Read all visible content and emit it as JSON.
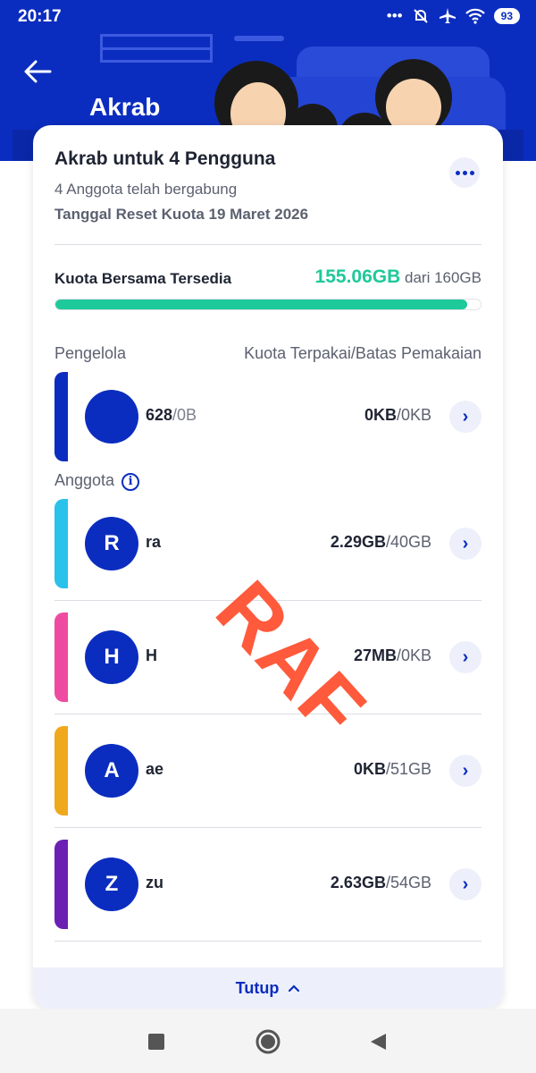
{
  "status_bar": {
    "time": "20:17",
    "battery": "93",
    "icons": [
      "more-dots-icon",
      "mute-bell-icon",
      "airplane-icon",
      "wifi-icon",
      "battery-icon"
    ]
  },
  "header": {
    "title": "Akrab"
  },
  "plan": {
    "title": "Akrab untuk 4 Pengguna",
    "members_joined": "4 Anggota telah bergabung",
    "reset_date": "Tanggal Reset Kuota 19 Maret 2026"
  },
  "quota": {
    "label": "Kuota Bersama Tersedia",
    "available": "155.06GB",
    "total_text": "dari 160GB",
    "available_fraction": 0.969
  },
  "manager_section": {
    "left_label": "Pengelola",
    "right_label": "Kuota Terpakai/Batas Pemakaian",
    "manager": {
      "name": "628",
      "name_faint": "/0B",
      "used": "0KB",
      "limit": "/0KB",
      "accent": "#0b2dbf"
    }
  },
  "members_section": {
    "label": "Anggota",
    "members": [
      {
        "initial": "R",
        "name": "ra",
        "used": "2.29GB",
        "limit": "/40GB",
        "accent": "#29c2ea"
      },
      {
        "initial": "H",
        "name": "H",
        "used": "27MB",
        "limit": "/0KB",
        "accent": "#ef4aa1"
      },
      {
        "initial": "A",
        "name": "ae",
        "used": "0KB",
        "limit": "/51GB",
        "accent": "#f0a91c"
      },
      {
        "initial": "Z",
        "name": "zu",
        "used": "2.63GB",
        "limit": "/54GB",
        "accent": "#6c20b3"
      }
    ]
  },
  "footer": {
    "close_label": "Tutup"
  },
  "watermark": {
    "text": "RAF",
    "color": "#ff5a3c"
  },
  "colors": {
    "brand": "#0b2dbf",
    "quota_green": "#1ec99a"
  }
}
